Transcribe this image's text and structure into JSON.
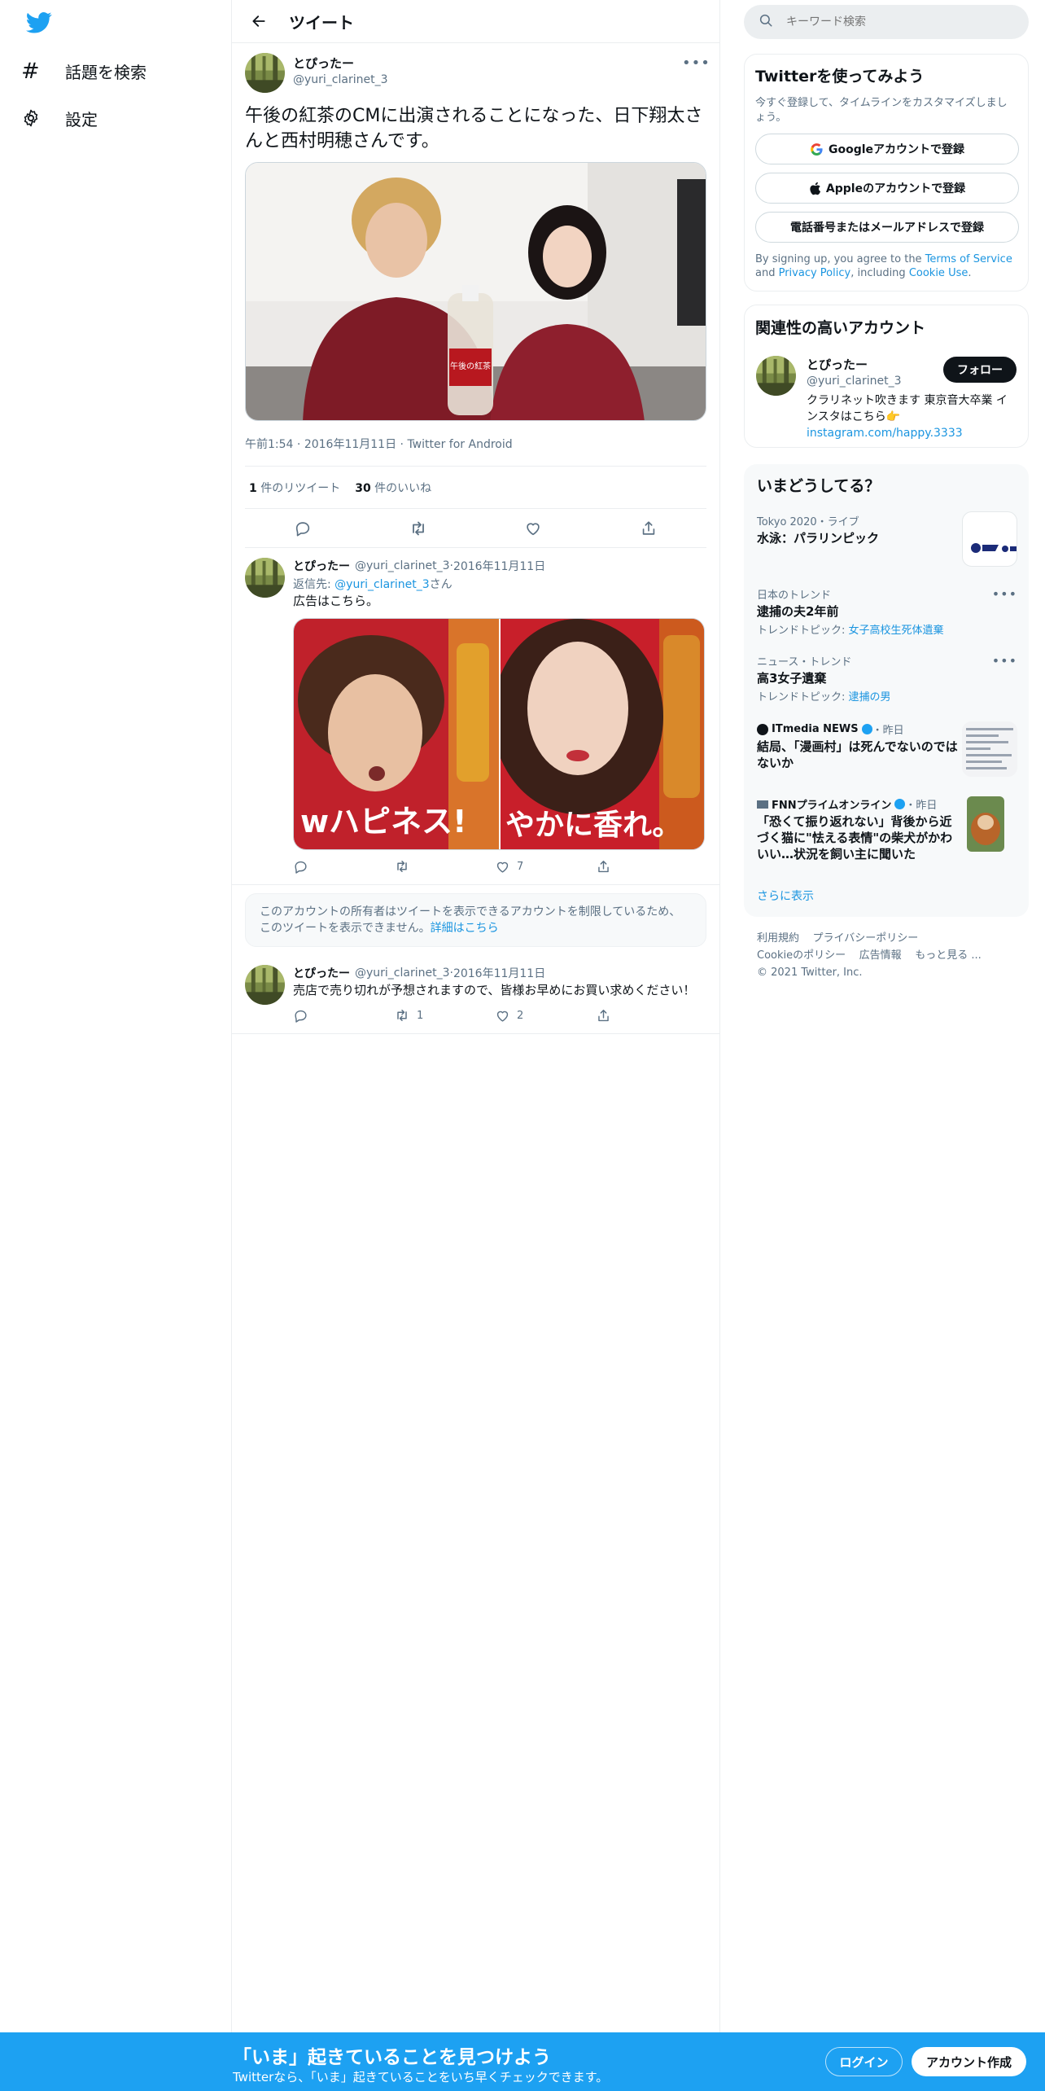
{
  "nav": {
    "explore_label": "話題を検索",
    "settings_label": "設定"
  },
  "header": {
    "title": "ツイート"
  },
  "main_tweet": {
    "display_name": "とぴったー",
    "handle": "@yuri_clarinet_3",
    "text": "午後の紅茶のCMに出演されることになった、日下翔太さんと西村明穂さんです。",
    "time": "午前1:54",
    "date": "2016年11月11日",
    "client": "Twitter for Android",
    "retweet_count": "1",
    "retweet_label": " 件のリツイート",
    "like_count": "30",
    "like_label": " 件のいいね",
    "photo_label": "午後の紅茶"
  },
  "reply1": {
    "display_name": "とぴったー",
    "handle": "@yuri_clarinet_3",
    "date": "2016年11月11日",
    "reply_prefix": "返信先: ",
    "reply_to": "@yuri_clarinet_3",
    "reply_suffix": "さん",
    "text": "広告はこちら。",
    "like_count": "7",
    "media_left_text": "wハピネス!",
    "media_right_text": "やかに香れ。"
  },
  "notice": {
    "text": "このアカウントの所有者はツイートを表示できるアカウントを制限しているため、このツイートを表示できません。",
    "link": "詳細はこちら"
  },
  "reply2": {
    "display_name": "とぴったー",
    "handle": "@yuri_clarinet_3",
    "date": "2016年11月11日",
    "text": "売店で売り切れが予想されますので、皆様お早めにお買い求めください！",
    "retweet_count": "1",
    "like_count": "2"
  },
  "search": {
    "placeholder": "キーワード検索"
  },
  "signup": {
    "title": "Twitterを使ってみよう",
    "subtitle": "今すぐ登録して、タイムラインをカスタマイズしましょう。",
    "google": "Googleアカウントで登録",
    "apple": "Appleのアカウントで登録",
    "phone": "電話番号またはメールアドレスで登録",
    "legal_1": "By signing up, you agree to the ",
    "terms": "Terms of Service",
    "legal_2": " and ",
    "privacy": "Privacy Policy",
    "legal_3": ", including ",
    "cookie": "Cookie Use",
    "legal_4": "."
  },
  "related": {
    "title": "関連性の高いアカウント",
    "display_name": "とぴったー",
    "handle": "@yuri_clarinet_3",
    "follow": "フォロー",
    "bio": "クラリネット吹きます 東京音大卒業 インスタはこちら👉",
    "link": "instagram.com/happy.3333"
  },
  "trends": {
    "title": "いまどうしてる？",
    "items": [
      {
        "category": "Tokyo 2020・ライブ",
        "name": "水泳：パラリンピック"
      },
      {
        "category": "日本のトレンド",
        "name": "逮捕の夫2年前",
        "sub_prefix": "トレンドトピック: ",
        "sub_link": "女子高校生死体遺棄"
      },
      {
        "category": "ニュース・トレンド",
        "name": "高3女子遺棄",
        "sub_prefix": "トレンドトピック: ",
        "sub_link": "逮捕の男"
      },
      {
        "source": "ITmedia NEWS",
        "time": "・昨日",
        "name": "結局、「漫画村」は死んでないのではないか"
      },
      {
        "source": "FNNプライムオンライン",
        "time": "・昨日",
        "name": "「恐くて振り返れない」背後から近づく猫に\"怯える表情\"の柴犬がかわいい…状況を飼い主に聞いた"
      }
    ],
    "show_more": "さらに表示"
  },
  "footer": {
    "terms": "利用規約",
    "privacy": "プライバシーポリシー",
    "cookie": "Cookieのポリシー",
    "ads": "広告情報",
    "more": "もっと見る ...",
    "copyright": "© 2021 Twitter, Inc."
  },
  "banner": {
    "title": "「いま」起きていることを見つけよう",
    "subtitle": "Twitterなら、「いま」起きていることをいち早くチェックできます。",
    "login": "ログイン",
    "signup": "アカウント作成"
  },
  "colors": {
    "accent": "#1da1f2",
    "link": "#1b95e0",
    "text": "#0f1419",
    "muted": "#5b7083"
  }
}
